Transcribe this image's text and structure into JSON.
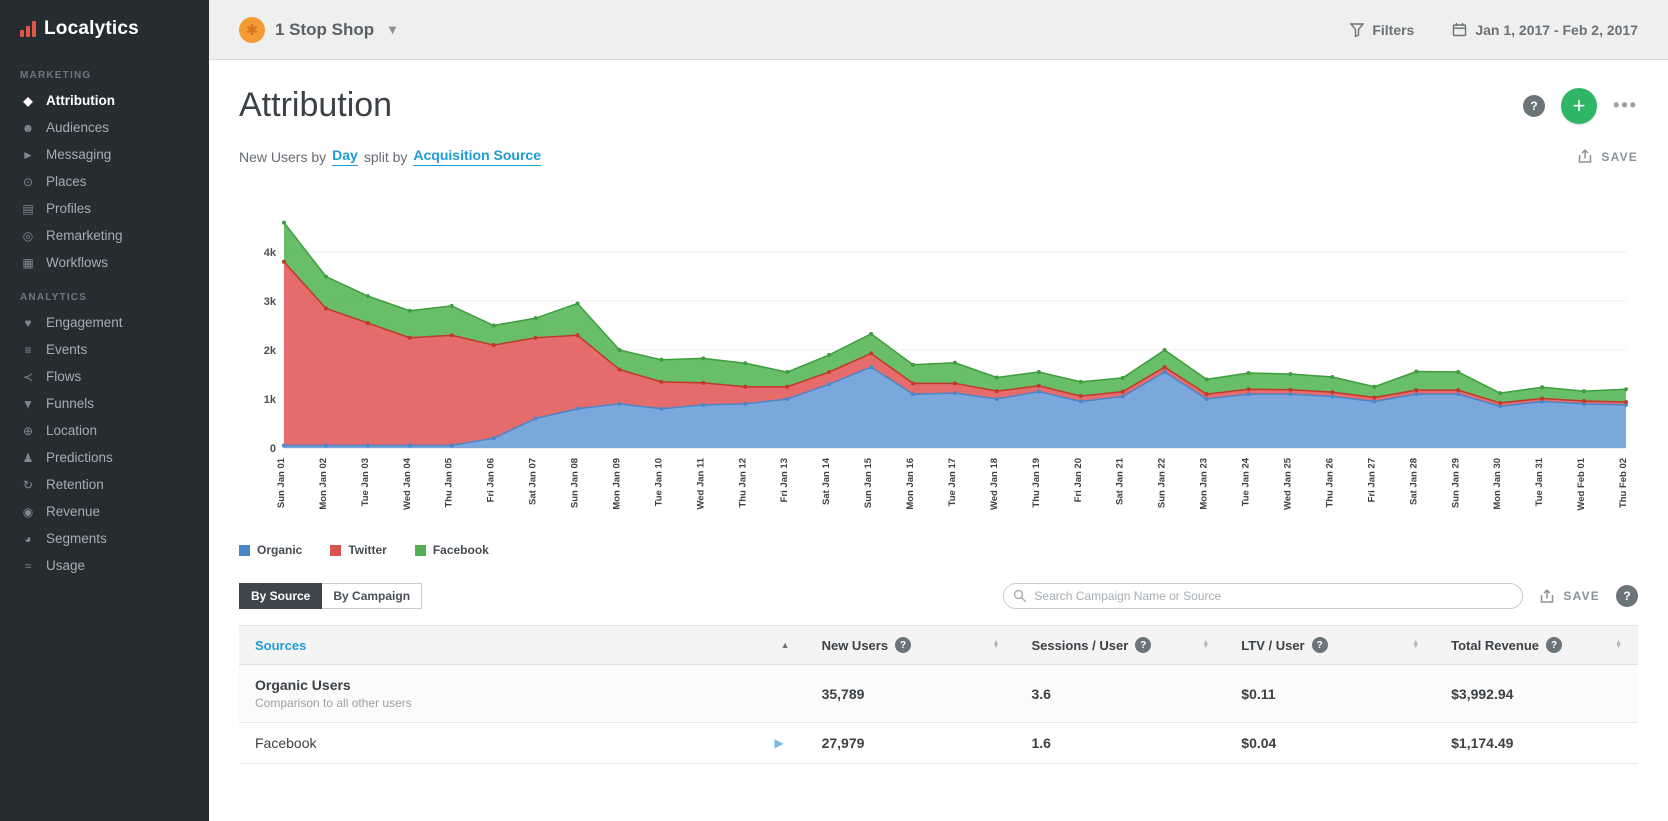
{
  "brand": {
    "name": "Localytics"
  },
  "topbar": {
    "app_name": "1 Stop Shop",
    "filters_label": "Filters",
    "date_range": "Jan 1, 2017 - Feb 2, 2017"
  },
  "sidebar": {
    "sections": [
      {
        "title": "MARKETING",
        "items": [
          {
            "name": "attribution",
            "icon_name": "tag-icon",
            "icon": "◆",
            "label": "Attribution",
            "active": true
          },
          {
            "name": "audiences",
            "icon_name": "people-icon",
            "icon": "☻",
            "label": "Audiences",
            "active": false
          },
          {
            "name": "messaging",
            "icon_name": "megaphone-icon",
            "icon": "►",
            "label": "Messaging",
            "active": false
          },
          {
            "name": "places",
            "icon_name": "map-pin-icon",
            "icon": "⊙",
            "label": "Places",
            "active": false
          },
          {
            "name": "profiles",
            "icon_name": "profile-card-icon",
            "icon": "▤",
            "label": "Profiles",
            "active": false
          },
          {
            "name": "remarketing",
            "icon_name": "target-icon",
            "icon": "◎",
            "label": "Remarketing",
            "active": false
          },
          {
            "name": "workflows",
            "icon_name": "workflow-icon",
            "icon": "▦",
            "label": "Workflows",
            "active": false
          }
        ]
      },
      {
        "title": "ANALYTICS",
        "items": [
          {
            "name": "engagement",
            "icon_name": "heart-icon",
            "icon": "♥",
            "label": "Engagement",
            "active": false
          },
          {
            "name": "events",
            "icon_name": "list-icon",
            "icon": "≡",
            "label": "Events",
            "active": false
          },
          {
            "name": "flows",
            "icon_name": "flow-icon",
            "icon": "≺",
            "label": "Flows",
            "active": false
          },
          {
            "name": "funnels",
            "icon_name": "funnel-icon",
            "icon": "▼",
            "label": "Funnels",
            "active": false
          },
          {
            "name": "location",
            "icon_name": "globe-icon",
            "icon": "⊕",
            "label": "Location",
            "active": false
          },
          {
            "name": "predictions",
            "icon_name": "person-icon",
            "icon": "♟",
            "label": "Predictions",
            "active": false
          },
          {
            "name": "retention",
            "icon_name": "refresh-icon",
            "icon": "↻",
            "label": "Retention",
            "active": false
          },
          {
            "name": "revenue",
            "icon_name": "coin-icon",
            "icon": "◉",
            "label": "Revenue",
            "active": false
          },
          {
            "name": "segments",
            "icon_name": "pie-icon",
            "icon": "◕",
            "label": "Segments",
            "active": false
          },
          {
            "name": "usage",
            "icon_name": "pulse-icon",
            "icon": "≈",
            "label": "Usage",
            "active": false
          }
        ]
      }
    ]
  },
  "header": {
    "title": "Attribution"
  },
  "query_bar": {
    "prefix": "New Users by",
    "dimension": "Day",
    "middle": "split by",
    "split": "Acquisition Source",
    "save_label": "SAVE"
  },
  "legend": [
    {
      "label": "Organic",
      "color": "#4a86c8"
    },
    {
      "label": "Twitter",
      "color": "#d9534f"
    },
    {
      "label": "Facebook",
      "color": "#54b054"
    }
  ],
  "tabs": {
    "by_source": "By Source",
    "by_campaign": "By Campaign"
  },
  "search": {
    "placeholder": "Search Campaign Name or Source"
  },
  "table_toolbar": {
    "save_label": "SAVE"
  },
  "table": {
    "columns": [
      "Sources",
      "New Users",
      "Sessions / User",
      "LTV / User",
      "Total Revenue"
    ],
    "rows": [
      {
        "source": "Organic Users",
        "subtitle": "Comparison to all other users",
        "new_users": "35,789",
        "sessions_per_user": "3.6",
        "ltv_per_user": "$0.11",
        "total_revenue": "$3,992.94"
      },
      {
        "source": "Facebook",
        "new_users": "27,979",
        "sessions_per_user": "1.6",
        "ltv_per_user": "$0.04",
        "total_revenue": "$1,174.49"
      }
    ]
  },
  "chart_data": {
    "type": "area",
    "stacked": true,
    "title": "New Users by Day split by Acquisition Source",
    "categories": [
      "Sun Jan 01",
      "Mon Jan 02",
      "Tue Jan 03",
      "Wed Jan 04",
      "Thu Jan 05",
      "Fri Jan 06",
      "Sat Jan 07",
      "Sun Jan 08",
      "Mon Jan 09",
      "Tue Jan 10",
      "Wed Jan 11",
      "Thu Jan 12",
      "Fri Jan 13",
      "Sat Jan 14",
      "Sun Jan 15",
      "Mon Jan 16",
      "Tue Jan 17",
      "Wed Jan 18",
      "Thu Jan 19",
      "Fri Jan 20",
      "Sat Jan 21",
      "Sun Jan 22",
      "Mon Jan 23",
      "Tue Jan 24",
      "Wed Jan 25",
      "Thu Jan 26",
      "Fri Jan 27",
      "Sat Jan 28",
      "Sun Jan 29",
      "Mon Jan 30",
      "Tue Jan 31",
      "Wed Feb 01",
      "Thu Feb 02"
    ],
    "series": [
      {
        "name": "Organic",
        "fill": "#6fa1d9",
        "line": "#4a86c8",
        "values": [
          50,
          50,
          50,
          50,
          50,
          200,
          600,
          800,
          900,
          800,
          880,
          900,
          1000,
          1300,
          1650,
          1100,
          1120,
          1000,
          1150,
          950,
          1050,
          1550,
          1000,
          1100,
          1100,
          1050,
          950,
          1100,
          1100,
          850,
          950,
          900,
          880
        ]
      },
      {
        "name": "Twitter",
        "fill": "#e25f5f",
        "line": "#c0392b",
        "values": [
          3750,
          2800,
          2500,
          2200,
          2250,
          1900,
          1650,
          1500,
          700,
          550,
          450,
          350,
          250,
          250,
          280,
          220,
          200,
          160,
          120,
          110,
          100,
          100,
          100,
          100,
          90,
          90,
          80,
          80,
          80,
          70,
          60,
          60,
          60
        ]
      },
      {
        "name": "Facebook",
        "fill": "#5cb85c",
        "line": "#3e9d3e",
        "values": [
          800,
          650,
          550,
          550,
          600,
          400,
          400,
          650,
          400,
          450,
          500,
          480,
          300,
          350,
          400,
          380,
          420,
          280,
          280,
          290,
          280,
          350,
          300,
          330,
          320,
          310,
          220,
          380,
          370,
          200,
          230,
          200,
          260
        ]
      }
    ],
    "xlabel": "",
    "ylabel": "",
    "ylim": [
      0,
      5000
    ],
    "yticks": [
      0,
      1000,
      2000,
      3000,
      4000
    ],
    "ytick_labels": [
      "0",
      "1k",
      "2k",
      "3k",
      "4k"
    ],
    "grid": true,
    "legend_position": "bottom"
  }
}
